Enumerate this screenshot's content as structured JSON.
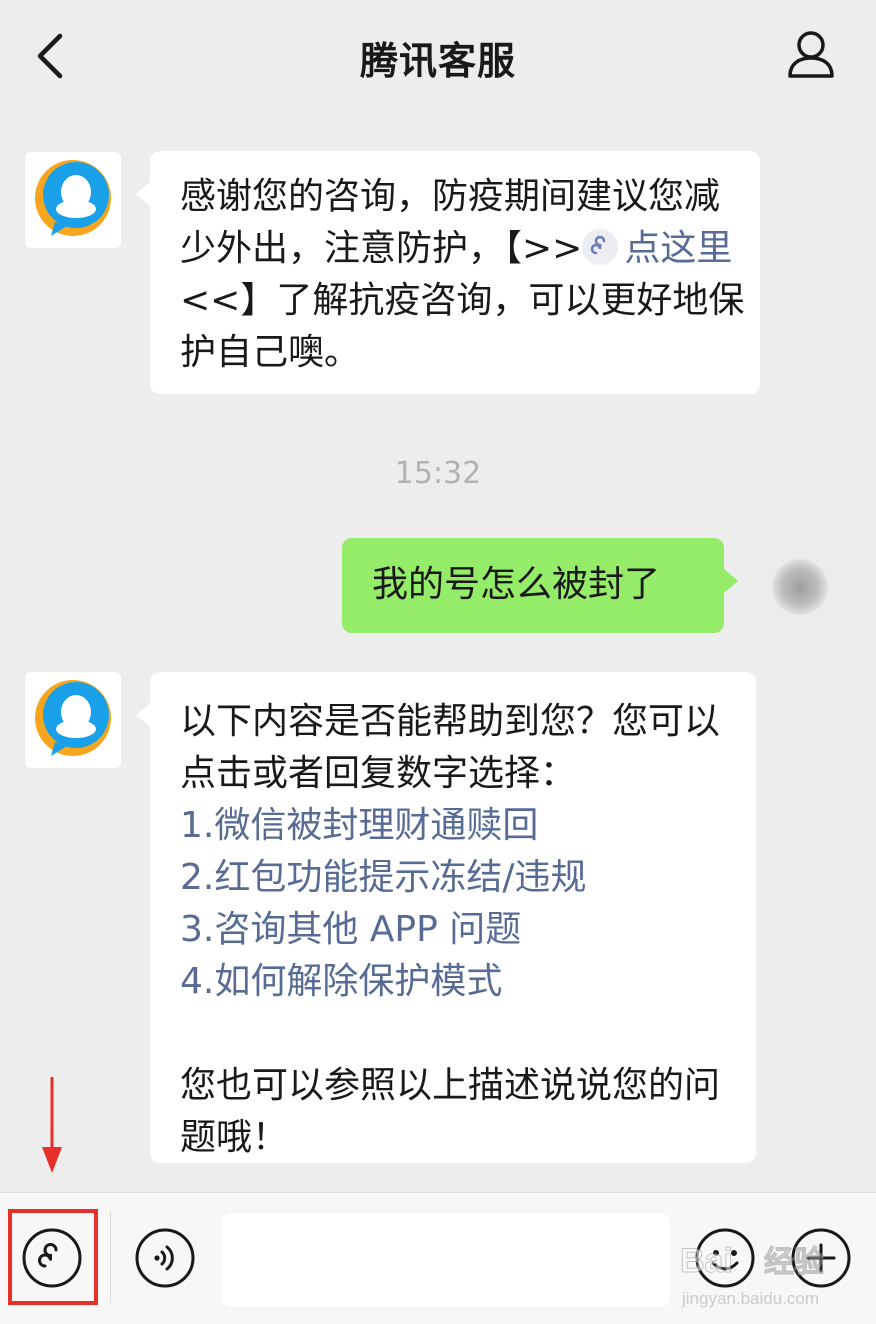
{
  "header": {
    "title": "腾讯客服",
    "back_icon": "chevron-left-icon",
    "profile_icon": "user-profile-icon"
  },
  "messages": [
    {
      "sender": "bot",
      "parts": {
        "text_a": "感谢您的咨询，防疫期间建议您减少外出，注意防护，【>>",
        "link": "点这里",
        "text_b": "<<】了解抗疫咨询，可以更好地保护自己噢。"
      }
    },
    {
      "sender": "user",
      "text": "我的号怎么被封了"
    },
    {
      "sender": "bot",
      "intro": "以下内容是否能帮助到您？您可以点击或者回复数字选择：",
      "options": [
        "1.微信被封理财通赎回",
        "2.红包功能提示冻结/违规",
        "3.咨询其他 APP 问题",
        "4.如何解除保护模式"
      ],
      "outro": "您也可以参照以上描述说说您的问题哦！"
    }
  ],
  "timestamp": "15:32",
  "toolbar": {
    "mini_program_icon": "mini-program-icon",
    "voice_icon": "voice-icon",
    "input_value": "",
    "emoji_icon": "emoji-icon",
    "plus_icon": "plus-icon"
  },
  "colors": {
    "background": "#ededed",
    "user_bubble": "#95ec69",
    "bot_bubble": "#ffffff",
    "link": "#576b95",
    "annotation": "#e8302a"
  },
  "watermark": {
    "brand": "Bai",
    "brand2": "经验",
    "url": "jingyan.baidu.com"
  }
}
